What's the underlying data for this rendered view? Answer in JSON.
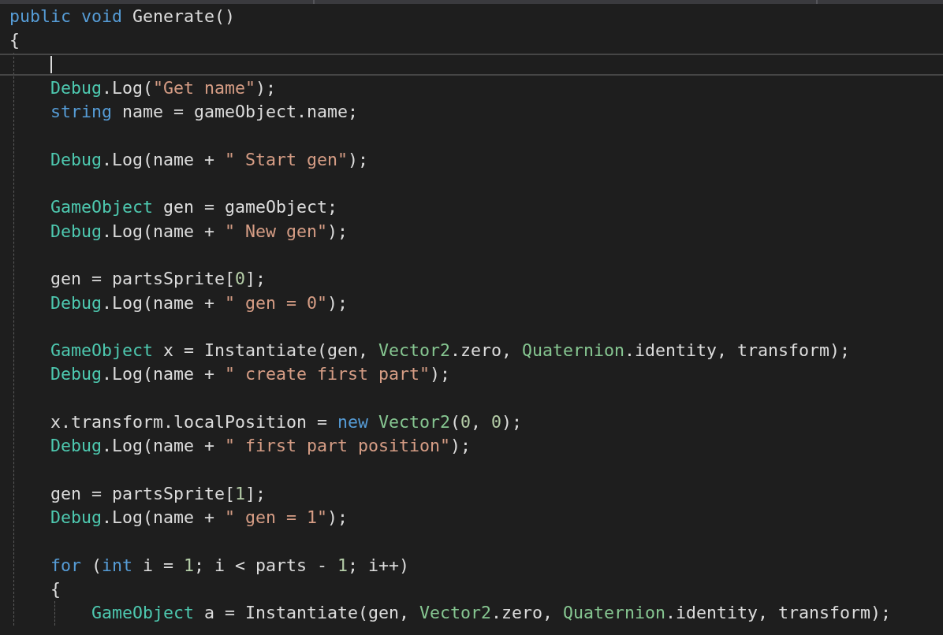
{
  "editor": {
    "lines": [
      {
        "kind": "code",
        "current": false,
        "tokens": [
          {
            "kind": "keyword",
            "text": "public"
          },
          {
            "kind": "keyword",
            "text": " void"
          },
          {
            "kind": "plain",
            "text": " Generate()"
          }
        ]
      },
      {
        "kind": "code",
        "current": false,
        "tokens": [
          {
            "kind": "plain",
            "text": "{"
          }
        ],
        "children": [
          {
            "kind": "blank",
            "current": true
          },
          {
            "kind": "code",
            "current": false,
            "tokens": [
              {
                "kind": "type",
                "text": "Debug"
              },
              {
                "kind": "plain",
                "text": ".Log("
              },
              {
                "kind": "string",
                "text": "\"Get name\""
              },
              {
                "kind": "plain",
                "text": ");"
              }
            ]
          },
          {
            "kind": "code",
            "current": false,
            "tokens": [
              {
                "kind": "keyword",
                "text": "string"
              },
              {
                "kind": "plain",
                "text": " name = gameObject.name;"
              }
            ]
          },
          {
            "kind": "blank",
            "current": false
          },
          {
            "kind": "code",
            "current": false,
            "tokens": [
              {
                "kind": "type",
                "text": "Debug"
              },
              {
                "kind": "plain",
                "text": ".Log(name + "
              },
              {
                "kind": "string",
                "text": "\" Start gen\""
              },
              {
                "kind": "plain",
                "text": ");"
              }
            ]
          },
          {
            "kind": "blank",
            "current": false
          },
          {
            "kind": "code",
            "current": false,
            "tokens": [
              {
                "kind": "type",
                "text": "GameObject"
              },
              {
                "kind": "plain",
                "text": " gen = gameObject;"
              }
            ]
          },
          {
            "kind": "code",
            "current": false,
            "tokens": [
              {
                "kind": "type",
                "text": "Debug"
              },
              {
                "kind": "plain",
                "text": ".Log(name + "
              },
              {
                "kind": "string",
                "text": "\" New gen\""
              },
              {
                "kind": "plain",
                "text": ");"
              }
            ]
          },
          {
            "kind": "blank",
            "current": false
          },
          {
            "kind": "code",
            "current": false,
            "tokens": [
              {
                "kind": "plain",
                "text": "gen = partsSprite["
              },
              {
                "kind": "number",
                "text": "0"
              },
              {
                "kind": "plain",
                "text": "];"
              }
            ]
          },
          {
            "kind": "code",
            "current": false,
            "tokens": [
              {
                "kind": "type",
                "text": "Debug"
              },
              {
                "kind": "plain",
                "text": ".Log(name + "
              },
              {
                "kind": "string",
                "text": "\" gen = 0\""
              },
              {
                "kind": "plain",
                "text": ");"
              }
            ]
          },
          {
            "kind": "blank",
            "current": false
          },
          {
            "kind": "code",
            "current": false,
            "tokens": [
              {
                "kind": "type",
                "text": "GameObject"
              },
              {
                "kind": "plain",
                "text": " x = Instantiate(gen, "
              },
              {
                "kind": "struct",
                "text": "Vector2"
              },
              {
                "kind": "plain",
                "text": ".zero, "
              },
              {
                "kind": "struct",
                "text": "Quaternion"
              },
              {
                "kind": "plain",
                "text": ".identity, transform);"
              }
            ]
          },
          {
            "kind": "code",
            "current": false,
            "tokens": [
              {
                "kind": "type",
                "text": "Debug"
              },
              {
                "kind": "plain",
                "text": ".Log(name + "
              },
              {
                "kind": "string",
                "text": "\" create first part\""
              },
              {
                "kind": "plain",
                "text": ");"
              }
            ]
          },
          {
            "kind": "blank",
            "current": false
          },
          {
            "kind": "code",
            "current": false,
            "tokens": [
              {
                "kind": "plain",
                "text": "x.transform.localPosition = "
              },
              {
                "kind": "keyword",
                "text": "new"
              },
              {
                "kind": "struct",
                "text": " Vector2"
              },
              {
                "kind": "plain",
                "text": "("
              },
              {
                "kind": "number",
                "text": "0"
              },
              {
                "kind": "plain",
                "text": ", "
              },
              {
                "kind": "number",
                "text": "0"
              },
              {
                "kind": "plain",
                "text": ");"
              }
            ]
          },
          {
            "kind": "code",
            "current": false,
            "tokens": [
              {
                "kind": "type",
                "text": "Debug"
              },
              {
                "kind": "plain",
                "text": ".Log(name + "
              },
              {
                "kind": "string",
                "text": "\" first part position\""
              },
              {
                "kind": "plain",
                "text": ");"
              }
            ]
          },
          {
            "kind": "blank",
            "current": false
          },
          {
            "kind": "code",
            "current": false,
            "tokens": [
              {
                "kind": "plain",
                "text": "gen = partsSprite["
              },
              {
                "kind": "number",
                "text": "1"
              },
              {
                "kind": "plain",
                "text": "];"
              }
            ]
          },
          {
            "kind": "code",
            "current": false,
            "tokens": [
              {
                "kind": "type",
                "text": "Debug"
              },
              {
                "kind": "plain",
                "text": ".Log(name + "
              },
              {
                "kind": "string",
                "text": "\" gen = 1\""
              },
              {
                "kind": "plain",
                "text": ");"
              }
            ]
          },
          {
            "kind": "blank",
            "current": false
          },
          {
            "kind": "code",
            "current": false,
            "tokens": [
              {
                "kind": "keyword",
                "text": "for"
              },
              {
                "kind": "plain",
                "text": " ("
              },
              {
                "kind": "keyword",
                "text": "int"
              },
              {
                "kind": "plain",
                "text": " i = "
              },
              {
                "kind": "number",
                "text": "1"
              },
              {
                "kind": "plain",
                "text": "; i < parts - "
              },
              {
                "kind": "number",
                "text": "1"
              },
              {
                "kind": "plain",
                "text": "; i++)"
              }
            ]
          },
          {
            "kind": "code",
            "current": false,
            "tokens": [
              {
                "kind": "plain",
                "text": "{"
              }
            ],
            "children": [
              {
                "kind": "code",
                "current": false,
                "tokens": [
                  {
                    "kind": "type",
                    "text": "GameObject"
                  },
                  {
                    "kind": "plain",
                    "text": " a = Instantiate(gen, "
                  },
                  {
                    "kind": "struct",
                    "text": "Vector2"
                  },
                  {
                    "kind": "plain",
                    "text": ".zero, "
                  },
                  {
                    "kind": "struct",
                    "text": "Quaternion"
                  },
                  {
                    "kind": "plain",
                    "text": ".identity, transform);"
                  }
                ]
              }
            ]
          }
        ]
      }
    ]
  }
}
